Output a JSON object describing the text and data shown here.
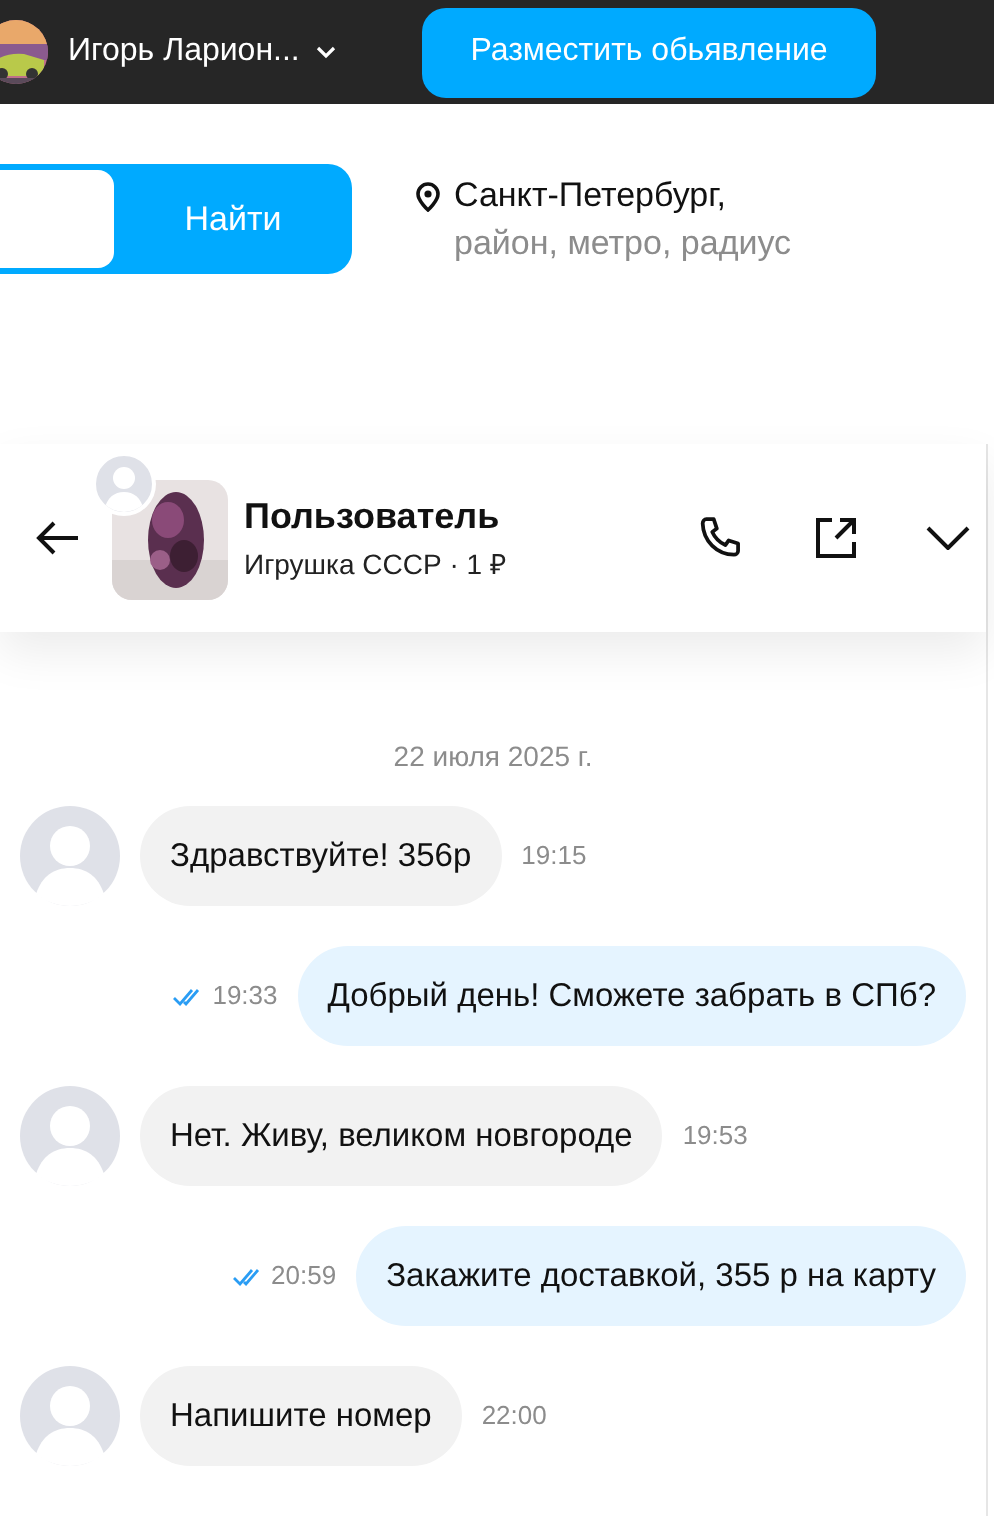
{
  "topbar": {
    "user_name": "Игорь Ларион...",
    "post_button": "Разместить обьявление"
  },
  "search": {
    "button": "Найти"
  },
  "location": {
    "city": "Санкт-Петербург,",
    "hint": "район, метро, радиус"
  },
  "chat": {
    "title": "Пользователь",
    "subtitle": "Игрушка СССР · 1 ₽",
    "date": "22 июля 2025 г.",
    "messages": [
      {
        "kind": "incoming",
        "text": "Здравствуйте! 356р",
        "time": "19:15"
      },
      {
        "kind": "outgoing",
        "text": "Добрый день! Сможете забрать в СПб?",
        "time": "19:33",
        "read": true
      },
      {
        "kind": "incoming",
        "text": "Нет. Живу, великом новгороде",
        "time": "19:53"
      },
      {
        "kind": "outgoing",
        "text": "Закажите доставкой, 355 р на карту",
        "time": "20:59",
        "read": true
      },
      {
        "kind": "incoming",
        "text": "Напишите номер",
        "time": "22:00"
      }
    ]
  }
}
